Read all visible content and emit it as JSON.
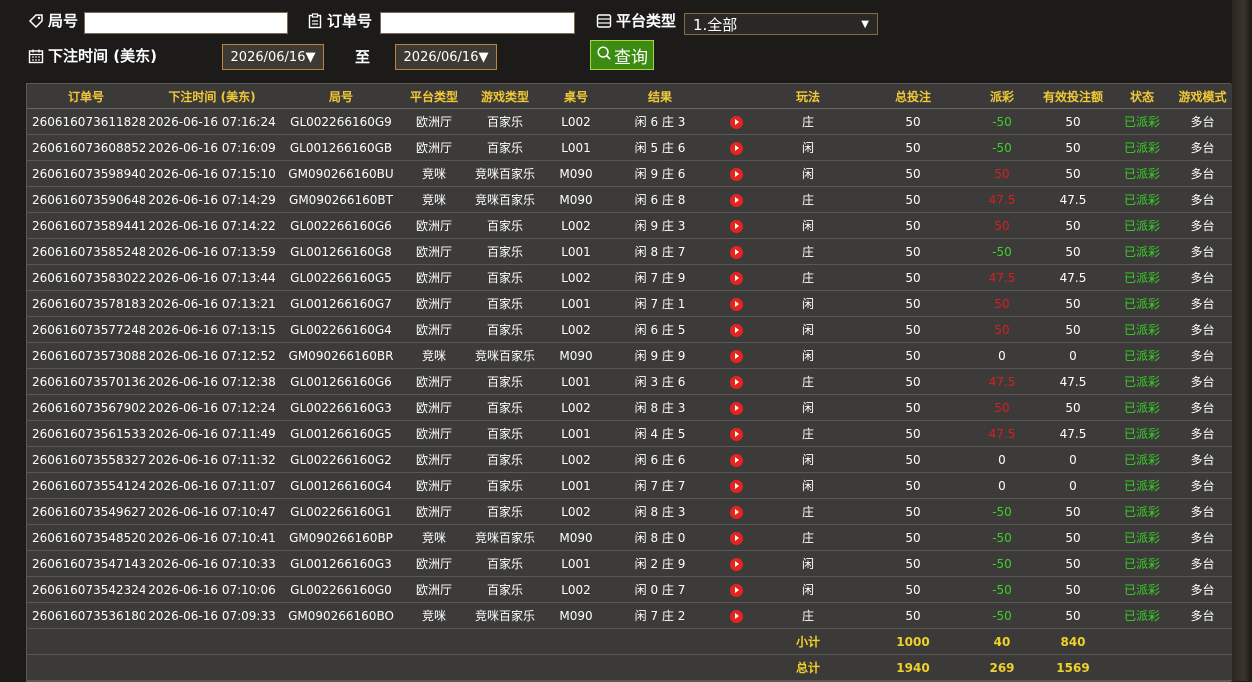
{
  "filters": {
    "round_label": "局号",
    "round_value": "",
    "order_label": "订单号",
    "order_value": "",
    "platform_label": "平台类型",
    "platform_selected": "1.全部",
    "time_label": "下注时间 (美东)",
    "date_from": "2026/06/16",
    "to_label": "至",
    "date_to": "2026/06/16",
    "query_label": "查询"
  },
  "table": {
    "headers": [
      "订单号",
      "下注时间 (美东)",
      "局号",
      "平台类型",
      "游戏类型",
      "桌号",
      "结果",
      "",
      "玩法",
      "总投注",
      "派彩",
      "有效投注额",
      "状态",
      "游戏模式"
    ],
    "rows": [
      {
        "order": "260616073611828",
        "time": "2026-06-16 07:16:24",
        "round": "GL002266160G9",
        "platform": "欧洲厅",
        "game": "百家乐",
        "table": "L002",
        "result": "闲 6 庄 3",
        "bet": "庄",
        "total": "50",
        "payout": "-50",
        "valid": "50",
        "status": "已派彩",
        "mode": "多台"
      },
      {
        "order": "260616073608852",
        "time": "2026-06-16 07:16:09",
        "round": "GL001266160GB",
        "platform": "欧洲厅",
        "game": "百家乐",
        "table": "L001",
        "result": "闲 5 庄 6",
        "bet": "闲",
        "total": "50",
        "payout": "-50",
        "valid": "50",
        "status": "已派彩",
        "mode": "多台"
      },
      {
        "order": "260616073598940",
        "time": "2026-06-16 07:15:10",
        "round": "GM090266160BU",
        "platform": "竞咪",
        "game": "竞咪百家乐",
        "table": "M090",
        "result": "闲 9 庄 6",
        "bet": "闲",
        "total": "50",
        "payout": "50",
        "valid": "50",
        "status": "已派彩",
        "mode": "多台"
      },
      {
        "order": "260616073590648",
        "time": "2026-06-16 07:14:29",
        "round": "GM090266160BT",
        "platform": "竞咪",
        "game": "竞咪百家乐",
        "table": "M090",
        "result": "闲 6 庄 8",
        "bet": "庄",
        "total": "50",
        "payout": "47.5",
        "valid": "47.5",
        "status": "已派彩",
        "mode": "多台"
      },
      {
        "order": "260616073589441",
        "time": "2026-06-16 07:14:22",
        "round": "GL002266160G6",
        "platform": "欧洲厅",
        "game": "百家乐",
        "table": "L002",
        "result": "闲 9 庄 3",
        "bet": "闲",
        "total": "50",
        "payout": "50",
        "valid": "50",
        "status": "已派彩",
        "mode": "多台"
      },
      {
        "order": "260616073585248",
        "time": "2026-06-16 07:13:59",
        "round": "GL001266160G8",
        "platform": "欧洲厅",
        "game": "百家乐",
        "table": "L001",
        "result": "闲 8 庄 7",
        "bet": "庄",
        "total": "50",
        "payout": "-50",
        "valid": "50",
        "status": "已派彩",
        "mode": "多台"
      },
      {
        "order": "260616073583022",
        "time": "2026-06-16 07:13:44",
        "round": "GL002266160G5",
        "platform": "欧洲厅",
        "game": "百家乐",
        "table": "L002",
        "result": "闲 7 庄 9",
        "bet": "庄",
        "total": "50",
        "payout": "47.5",
        "valid": "47.5",
        "status": "已派彩",
        "mode": "多台"
      },
      {
        "order": "260616073578183",
        "time": "2026-06-16 07:13:21",
        "round": "GL001266160G7",
        "platform": "欧洲厅",
        "game": "百家乐",
        "table": "L001",
        "result": "闲 7 庄 1",
        "bet": "闲",
        "total": "50",
        "payout": "50",
        "valid": "50",
        "status": "已派彩",
        "mode": "多台"
      },
      {
        "order": "260616073577248",
        "time": "2026-06-16 07:13:15",
        "round": "GL002266160G4",
        "platform": "欧洲厅",
        "game": "百家乐",
        "table": "L002",
        "result": "闲 6 庄 5",
        "bet": "闲",
        "total": "50",
        "payout": "50",
        "valid": "50",
        "status": "已派彩",
        "mode": "多台"
      },
      {
        "order": "260616073573088",
        "time": "2026-06-16 07:12:52",
        "round": "GM090266160BR",
        "platform": "竞咪",
        "game": "竞咪百家乐",
        "table": "M090",
        "result": "闲 9 庄 9",
        "bet": "闲",
        "total": "50",
        "payout": "0",
        "valid": "0",
        "status": "已派彩",
        "mode": "多台"
      },
      {
        "order": "260616073570136",
        "time": "2026-06-16 07:12:38",
        "round": "GL001266160G6",
        "platform": "欧洲厅",
        "game": "百家乐",
        "table": "L001",
        "result": "闲 3 庄 6",
        "bet": "庄",
        "total": "50",
        "payout": "47.5",
        "valid": "47.5",
        "status": "已派彩",
        "mode": "多台"
      },
      {
        "order": "260616073567902",
        "time": "2026-06-16 07:12:24",
        "round": "GL002266160G3",
        "platform": "欧洲厅",
        "game": "百家乐",
        "table": "L002",
        "result": "闲 8 庄 3",
        "bet": "闲",
        "total": "50",
        "payout": "50",
        "valid": "50",
        "status": "已派彩",
        "mode": "多台"
      },
      {
        "order": "260616073561533",
        "time": "2026-06-16 07:11:49",
        "round": "GL001266160G5",
        "platform": "欧洲厅",
        "game": "百家乐",
        "table": "L001",
        "result": "闲 4 庄 5",
        "bet": "庄",
        "total": "50",
        "payout": "47.5",
        "valid": "47.5",
        "status": "已派彩",
        "mode": "多台"
      },
      {
        "order": "260616073558327",
        "time": "2026-06-16 07:11:32",
        "round": "GL002266160G2",
        "platform": "欧洲厅",
        "game": "百家乐",
        "table": "L002",
        "result": "闲 6 庄 6",
        "bet": "闲",
        "total": "50",
        "payout": "0",
        "valid": "0",
        "status": "已派彩",
        "mode": "多台"
      },
      {
        "order": "260616073554124",
        "time": "2026-06-16 07:11:07",
        "round": "GL001266160G4",
        "platform": "欧洲厅",
        "game": "百家乐",
        "table": "L001",
        "result": "闲 7 庄 7",
        "bet": "闲",
        "total": "50",
        "payout": "0",
        "valid": "0",
        "status": "已派彩",
        "mode": "多台"
      },
      {
        "order": "260616073549627",
        "time": "2026-06-16 07:10:47",
        "round": "GL002266160G1",
        "platform": "欧洲厅",
        "game": "百家乐",
        "table": "L002",
        "result": "闲 8 庄 3",
        "bet": "庄",
        "total": "50",
        "payout": "-50",
        "valid": "50",
        "status": "已派彩",
        "mode": "多台"
      },
      {
        "order": "260616073548520",
        "time": "2026-06-16 07:10:41",
        "round": "GM090266160BP",
        "platform": "竞咪",
        "game": "竞咪百家乐",
        "table": "M090",
        "result": "闲 8 庄 0",
        "bet": "庄",
        "total": "50",
        "payout": "-50",
        "valid": "50",
        "status": "已派彩",
        "mode": "多台"
      },
      {
        "order": "260616073547143",
        "time": "2026-06-16 07:10:33",
        "round": "GL001266160G3",
        "platform": "欧洲厅",
        "game": "百家乐",
        "table": "L001",
        "result": "闲 2 庄 9",
        "bet": "闲",
        "total": "50",
        "payout": "-50",
        "valid": "50",
        "status": "已派彩",
        "mode": "多台"
      },
      {
        "order": "260616073542324",
        "time": "2026-06-16 07:10:06",
        "round": "GL002266160G0",
        "platform": "欧洲厅",
        "game": "百家乐",
        "table": "L002",
        "result": "闲 0 庄 7",
        "bet": "闲",
        "total": "50",
        "payout": "-50",
        "valid": "50",
        "status": "已派彩",
        "mode": "多台"
      },
      {
        "order": "260616073536180",
        "time": "2026-06-16 07:09:33",
        "round": "GM090266160BO",
        "platform": "竞咪",
        "game": "竞咪百家乐",
        "table": "M090",
        "result": "闲 7 庄 2",
        "bet": "庄",
        "total": "50",
        "payout": "-50",
        "valid": "50",
        "status": "已派彩",
        "mode": "多台"
      }
    ],
    "subtotal": {
      "label": "小计",
      "total": "1000",
      "payout": "40",
      "valid": "840"
    },
    "grand_total": {
      "label": "总计",
      "total": "1940",
      "payout": "269",
      "valid": "1569"
    }
  },
  "colors": {
    "header_text": "#f0c838",
    "payout_negative": "#39d126",
    "payout_positive": "#d42020",
    "status_paid": "#39d126",
    "summary_text": "#f0d12a",
    "query_button": "#3d8c12"
  },
  "icons": {
    "round": "tag-icon",
    "order": "clipboard-icon",
    "platform": "list-icon",
    "time": "calendar-icon",
    "query": "search-icon",
    "video": "play-icon"
  }
}
